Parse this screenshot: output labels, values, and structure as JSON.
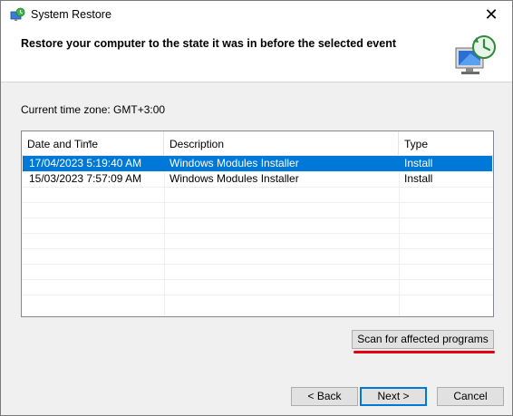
{
  "window": {
    "title": "System Restore",
    "close_glyph": "✕",
    "title_icon": "system-restore-icon"
  },
  "header": {
    "title": "Restore your computer to the state it was in before the selected event",
    "graphic_icon": "restore-computer-icon"
  },
  "timezone": {
    "label": "Current time zone: GMT+3:00"
  },
  "list": {
    "columns": [
      "Date and Time",
      "Description",
      "Type"
    ],
    "rows": [
      {
        "date": "17/04/2023 5:19:40 AM",
        "description": "Windows Modules Installer",
        "type": "Install",
        "selected": true
      },
      {
        "date": "15/03/2023 7:57:09 AM",
        "description": "Windows Modules Installer",
        "type": "Install",
        "selected": false
      }
    ],
    "sorted_column": "Date and Time"
  },
  "buttons": {
    "scan": "Scan for affected programs",
    "back": "< Back",
    "next": "Next >",
    "cancel": "Cancel"
  },
  "colors": {
    "selection": "#0078d7",
    "annotation": "#e0000f"
  }
}
